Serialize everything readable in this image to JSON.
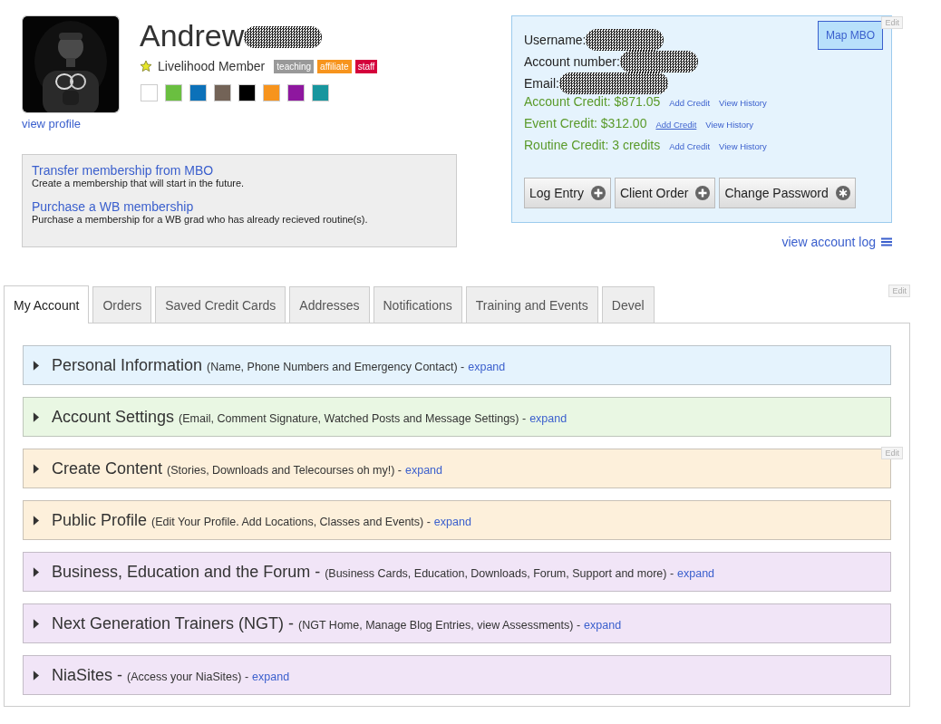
{
  "profile": {
    "name": "Andrew",
    "name_redacted": true,
    "membership": "Livelihood Member",
    "tags": [
      {
        "label": "teaching",
        "color": "#999999"
      },
      {
        "label": "affiliate",
        "color": "#f7941d"
      },
      {
        "label": "staff",
        "color": "#d4003b"
      }
    ],
    "swatches": [
      {
        "color": "#ffffff"
      },
      {
        "color": "#6abf40"
      },
      {
        "color": "#0c71b9"
      },
      {
        "color": "#736357"
      },
      {
        "color": "#000000"
      },
      {
        "color": "#f7941d"
      },
      {
        "color": "#8e179f"
      },
      {
        "color": "#17969e"
      }
    ],
    "view_profile": "view profile"
  },
  "membership_box": [
    {
      "link": "Transfer membership from MBO",
      "description": "Create a membership that will start in the future."
    },
    {
      "link": "Purchase a WB membership",
      "description": "Purchase a membership for a WB grad who has already recieved routine(s)."
    }
  ],
  "account": {
    "map_button": "Map MBO",
    "edit": "Edit",
    "fields": [
      {
        "label": "Username:",
        "redacted": true
      },
      {
        "label": "Account number:",
        "redacted": true
      },
      {
        "label": "Email:",
        "redacted": true
      }
    ],
    "credits": [
      {
        "label": "Account Credit: $871.05",
        "links": [
          {
            "text": "Add Credit",
            "hovered": false
          },
          {
            "text": "View History",
            "hovered": false
          }
        ]
      },
      {
        "label": "Event Credit: $312.00",
        "links": [
          {
            "text": "Add Credit",
            "hovered": true
          },
          {
            "text": "View History",
            "hovered": false
          }
        ]
      },
      {
        "label": "Routine Credit: 3 credits",
        "links": [
          {
            "text": "Add Credit",
            "hovered": false
          },
          {
            "text": "View History",
            "hovered": false
          }
        ]
      }
    ],
    "buttons": [
      {
        "label": "Log Entry",
        "kind": "plus"
      },
      {
        "label": "Client Order",
        "kind": "plus"
      },
      {
        "label": "Change Password",
        "kind": "asterisk"
      }
    ],
    "view_log": "view account log"
  },
  "tabs": [
    {
      "label": "My Account",
      "selected": true
    },
    {
      "label": "Orders",
      "selected": false
    },
    {
      "label": "Saved Credit Cards",
      "selected": false
    },
    {
      "label": "Addresses",
      "selected": false
    },
    {
      "label": "Notifications",
      "selected": false
    },
    {
      "label": "Training and Events",
      "selected": false
    },
    {
      "label": "Devel",
      "selected": false
    }
  ],
  "tabs_edit": "Edit",
  "sections": [
    {
      "title": "Personal Information",
      "description": "(Name, Phone Numbers and Emergency Contact) -",
      "link": "expand",
      "color": "#e5f3fd",
      "expanded": false
    },
    {
      "title": "Account Settings",
      "description": "(Email, Comment Signature, Watched Posts and Message Settings) -",
      "link": "expand",
      "color": "#e9f7e3",
      "expanded": false
    },
    {
      "title": "Create Content",
      "description": "(Stories, Downloads and Telecourses oh my!) -",
      "link": "expand",
      "color": "#fdf0db",
      "expanded": false,
      "edit": "Edit"
    },
    {
      "title": "Public Profile",
      "description": "(Edit Your Profile. Add Locations, Classes and Events) -",
      "link": "expand",
      "color": "#fdf0db",
      "expanded": false
    },
    {
      "title": "Business, Education and the Forum -",
      "description": "(Business Cards, Education, Downloads, Forum, Support and more) -",
      "link": "expand",
      "color": "#f1e5f7",
      "expanded": false
    },
    {
      "title": "Next Generation Trainers (NGT) -",
      "description": "(NGT Home, Manage Blog Entries, view Assessments) -",
      "link": "expand",
      "color": "#f1e5f7",
      "expanded": false
    },
    {
      "title": "NiaSites -",
      "description": "(Access your NiaSites) -",
      "link": "expand",
      "color": "#f1e5f7",
      "expanded": false
    }
  ]
}
